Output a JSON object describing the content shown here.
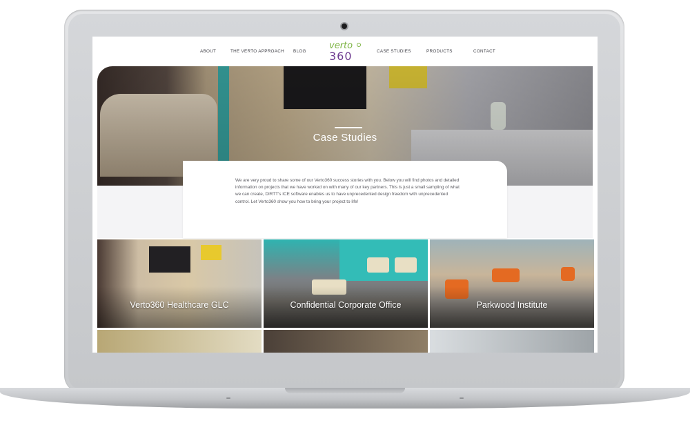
{
  "nav": {
    "items_left": [
      "ABOUT",
      "THE VERTO APPROACH",
      "BLOG"
    ],
    "items_right": [
      "CASE STUDIES",
      "PRODUCTS",
      "CONTACT"
    ],
    "logo_top": "verto",
    "logo_bottom": "360"
  },
  "hero": {
    "title": "Case Studies"
  },
  "intro": {
    "text": "We are very proud to share some of our Verto360 success stories with you. Below you will find photos and detailed information on projects that we have worked on with many of our key partners. This is just a small sampling of what we can create, DIRTT's ICE software enables us to have unprecedented design freedom with unprecedented control. Let Verto360 show you how to bring your project to life!"
  },
  "case_studies": [
    {
      "label": "Verto360 Healthcare GLC"
    },
    {
      "label": "Confidential Corporate Office"
    },
    {
      "label": "Parkwood Institute"
    }
  ],
  "colors": {
    "logo_green": "#7cb342",
    "logo_purple": "#6d3a8f",
    "nav_text": "#3e3e45",
    "intro_bg": "#f4f4f6"
  }
}
